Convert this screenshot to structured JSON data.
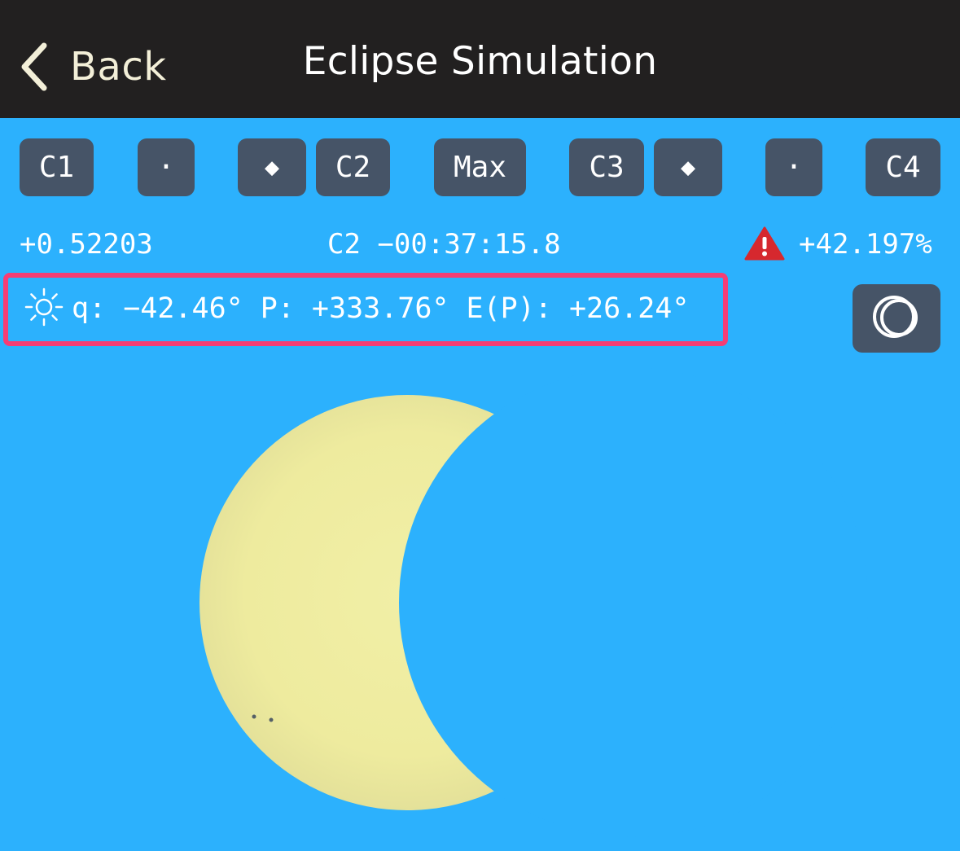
{
  "nav": {
    "back_label": "Back",
    "title": "Eclipse Simulation"
  },
  "contacts": {
    "c1": "C1",
    "dot_left": "·",
    "diamond_left": "◆",
    "c2": "C2",
    "max": "Max",
    "c3": "C3",
    "diamond_right": "◆",
    "dot_right": "·",
    "c4": "C4"
  },
  "info": {
    "magnitude": "+0.52203",
    "contact_time": "C2 −00:37:15.8",
    "obscuration": "+42.197%"
  },
  "sun_angles": {
    "q": "q: −42.46°",
    "p": "P: +333.76°",
    "ep": "E(P): +26.24°"
  },
  "icons": {
    "back": "chevron-left-icon",
    "warning": "warning-triangle-icon",
    "sun": "sun-icon",
    "rings": "overlapping-rings-icon"
  },
  "colors": {
    "sky": "#2cb1fd",
    "navbar": "#222020",
    "button": "#465467",
    "highlight": "#f53d75",
    "sun": "#eeeb9f",
    "warning": "#d6282e"
  }
}
